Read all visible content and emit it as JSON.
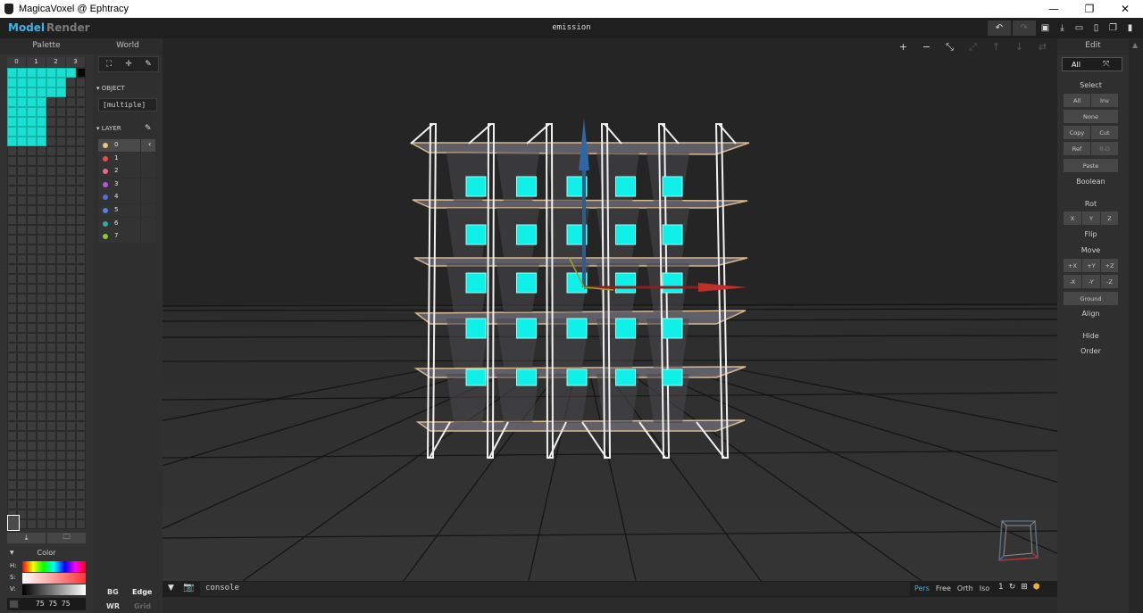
{
  "window": {
    "title": "MagicaVoxel @ Ephtracy",
    "min": "—",
    "restore": "❐",
    "close": "✕"
  },
  "topbar": {
    "mode_model": "Model",
    "mode_render": "Render",
    "doc_title": "emission",
    "icons": [
      "undo-icon",
      "redo-icon",
      "save-icon",
      "export-icon",
      "open-icon",
      "new-icon",
      "copy-file-icon",
      "delete-icon"
    ]
  },
  "palette": {
    "title": "Palette",
    "tabs": [
      "0",
      "1",
      "2",
      "3"
    ],
    "accent": "#19e0d0",
    "actions": {
      "save": "⤓",
      "open": "🗀"
    }
  },
  "color": {
    "title": "Color",
    "h_label": "H:",
    "s_label": "S:",
    "v_label": "V:",
    "rgb": "75  75  75"
  },
  "world": {
    "title": "World",
    "object_label": "OBJECT",
    "object_value": "[multiple]",
    "layer_label": "LAYER",
    "layers": [
      {
        "name": "0",
        "color": "#f0c27a"
      },
      {
        "name": "1",
        "color": "#e84d4d"
      },
      {
        "name": "2",
        "color": "#e86a8a"
      },
      {
        "name": "3",
        "color": "#b45ad0"
      },
      {
        "name": "4",
        "color": "#5a6ad8"
      },
      {
        "name": "5",
        "color": "#4f86d8"
      },
      {
        "name": "6",
        "color": "#36a8a0"
      },
      {
        "name": "7",
        "color": "#8cc43c"
      }
    ],
    "bottom": {
      "bg": "BG",
      "edge": "Edge",
      "wr": "WR",
      "grid": "Grid"
    }
  },
  "viewport": {
    "toolbar": [
      "+",
      "−"
    ]
  },
  "console": {
    "placeholder": "console",
    "views": [
      "Pers",
      "Free",
      "Orth",
      "Iso"
    ],
    "active_view": "Pers",
    "zoom": "1"
  },
  "edit": {
    "title": "Edit",
    "mode": "All",
    "select_label": "Select",
    "all": "All",
    "inv": "Inv",
    "none": "None",
    "copy": "Copy",
    "cut": "Cut",
    "ref": "Ref",
    "rd": "R-D",
    "paste": "Paste",
    "boolean": "Boolean",
    "rot": "Rot",
    "x": "X",
    "y": "Y",
    "z": "Z",
    "flip": "Flip",
    "move": "Move",
    "px": "+X",
    "py": "+Y",
    "pz": "+Z",
    "nx": "-X",
    "ny": "-Y",
    "nz": "-Z",
    "ground": "Ground",
    "align": "Align",
    "hide": "Hide",
    "order": "Order"
  }
}
